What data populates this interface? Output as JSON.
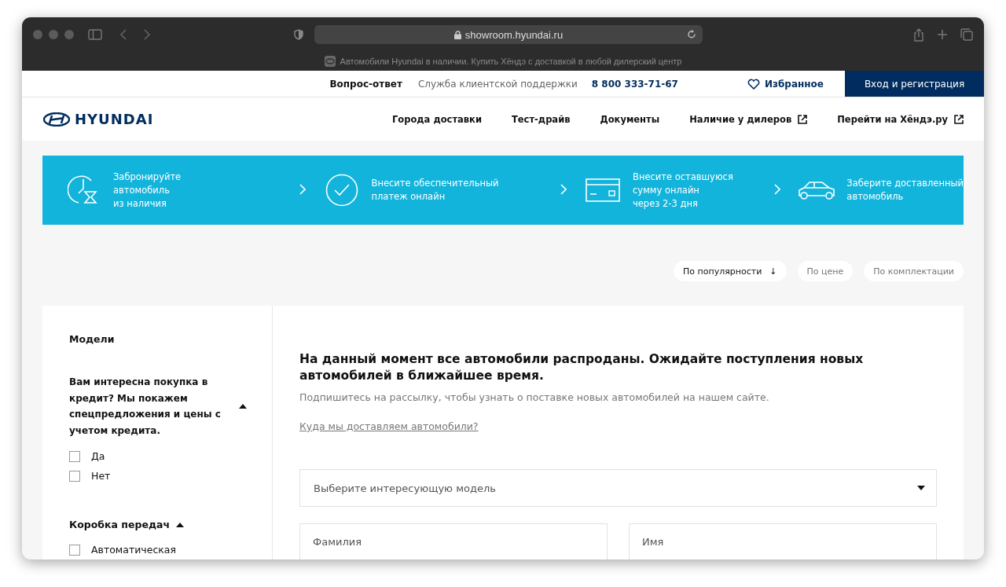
{
  "browser": {
    "url": "showroom.hyundai.ru",
    "tab_title": "Автомобили Hyundai в наличии. Купить Хёндэ с доставкой в любой дилерский центр"
  },
  "top_bar": {
    "faq": "Вопрос-ответ",
    "support": "Служба клиентской поддержки",
    "phone": "8 800 333-71-67",
    "favorites": "Избранное",
    "login": "Вход и регистрация"
  },
  "nav": {
    "logo": "HYUNDAI",
    "items": [
      {
        "label": "Города доставки",
        "external": false
      },
      {
        "label": "Тест-драйв",
        "external": false
      },
      {
        "label": "Документы",
        "external": false
      },
      {
        "label": "Наличие у дилеров",
        "external": true
      },
      {
        "label": "Перейти на Хёндэ.ру",
        "external": true
      }
    ]
  },
  "steps": [
    {
      "kind": "clock",
      "text": "Забронируйте\nавтомобиль\nиз наличия"
    },
    {
      "kind": "check",
      "text": "Внесите обеспечительный\nплатеж онлайн"
    },
    {
      "kind": "card",
      "text": "Внесите оставшуюся\nсумму онлайн\nчерез 2-3 дня"
    },
    {
      "kind": "car",
      "text": "Заберите доставленный\nавтомобиль"
    }
  ],
  "sort_options": [
    {
      "label": "По популярности",
      "arrow": "↓",
      "selected": true
    },
    {
      "label": "По цене",
      "selected": false
    },
    {
      "label": "По комплектации",
      "selected": false
    }
  ],
  "sidebar": {
    "sections": [
      {
        "kind": "plain",
        "title": "Модели"
      },
      {
        "kind": "question",
        "title": "Вам интересна покупка в кредит? Мы покажем спецпредложения и цены с учетом кредита.",
        "expanded": true,
        "options": [
          {
            "label": "Да",
            "checked": false
          },
          {
            "label": "Нет",
            "checked": false
          }
        ]
      },
      {
        "kind": "filter",
        "title": "Коробка передач",
        "expanded": true,
        "options": [
          {
            "label": "Автоматическая",
            "checked": false
          }
        ]
      }
    ]
  },
  "main": {
    "heading": "На данный момент все автомобили распроданы. Ожидайте поступления новых автомобилей в ближайшее время.",
    "subtitle": "Подпишитесь на рассылку, чтобы узнать о поставке новых автомобилей на нашем сайте.",
    "link": "Куда мы доставляем автомобили?",
    "model_select": {
      "placeholder": "Выберите интересующую модель"
    },
    "fields": [
      {
        "placeholder": "Фамилия"
      },
      {
        "placeholder": "Имя"
      }
    ]
  }
}
